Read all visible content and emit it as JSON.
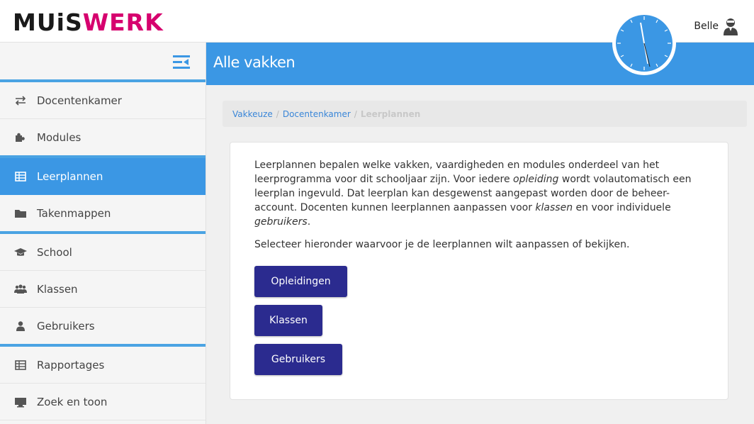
{
  "header": {
    "logo_left": "MUiS",
    "logo_right": "WERK",
    "user_name": "Belle"
  },
  "sidebar": {
    "items": [
      {
        "label": "Docentenkamer",
        "icon": "swap-arrows-icon"
      },
      {
        "label": "Modules",
        "icon": "puzzle-icon"
      },
      {
        "label": "Leerplannen",
        "icon": "table-icon",
        "active": true
      },
      {
        "label": "Takenmappen",
        "icon": "folder-icon"
      },
      {
        "label": "School",
        "icon": "graduation-cap-icon"
      },
      {
        "label": "Klassen",
        "icon": "users-icon"
      },
      {
        "label": "Gebruikers",
        "icon": "user-icon"
      },
      {
        "label": "Rapportages",
        "icon": "table-icon"
      },
      {
        "label": "Zoek en toon",
        "icon": "monitor-icon"
      }
    ]
  },
  "page": {
    "title": "Alle vakken"
  },
  "breadcrumb": {
    "items": [
      "Vakkeuze",
      "Docentenkamer"
    ],
    "current": "Leerplannen"
  },
  "content": {
    "p1_a": "Leerplannen bepalen welke vakken, vaardigheden en modules onderdeel van het leerprogramma voor dit schooljaar zijn. Voor iedere ",
    "p1_em1": "opleiding",
    "p1_b": " wordt volautomatisch een leerplan ingevuld. Dat leerplan kan desgewenst aangepast worden door de beheer-account. Docenten kunnen leerplannen aanpassen voor ",
    "p1_em2": "klassen",
    "p1_c": " en voor individuele ",
    "p1_em3": "gebruikers",
    "p1_d": ".",
    "p2": "Selecteer hieronder waarvoor je de leerplannen wilt aanpassen of bekijken.",
    "buttons": [
      "Opleidingen",
      "Klassen",
      "Gebruikers"
    ]
  },
  "colors": {
    "accent": "#3b97e4",
    "brand_pink": "#d6006e",
    "button": "#2b2b8f"
  }
}
